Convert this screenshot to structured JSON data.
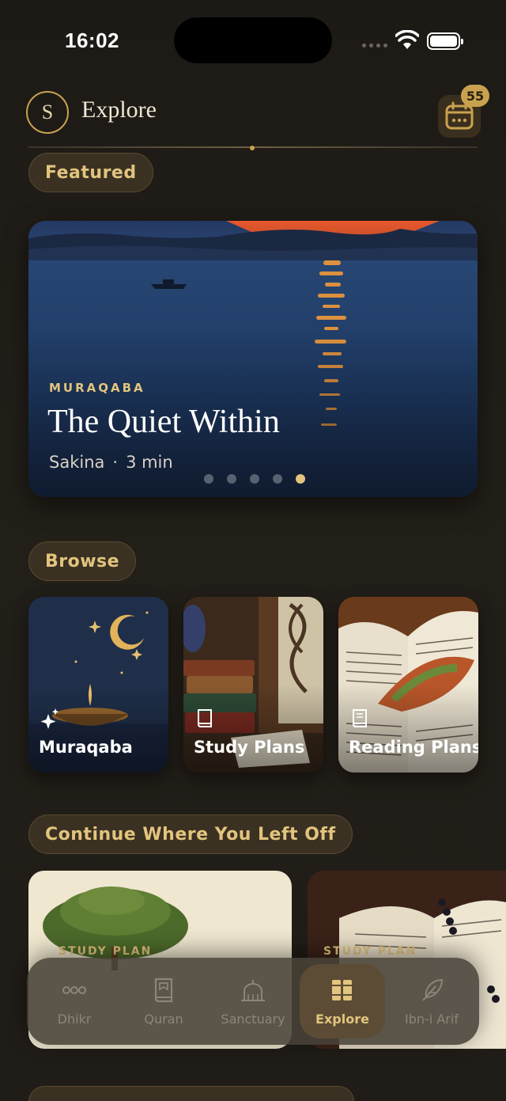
{
  "status_bar": {
    "time": "16:02"
  },
  "header": {
    "avatar_initial": "S",
    "title": "Explore",
    "notification_count": "55"
  },
  "featured": {
    "section_label": "Featured",
    "kicker": "MURAQABA",
    "title": "The Quiet Within",
    "author": "Sakina",
    "separator": "·",
    "duration": "3 min",
    "page_count": 5,
    "active_page": 5
  },
  "browse": {
    "section_label": "Browse",
    "cards": [
      {
        "label": "Muraqaba",
        "icon": "sparkles-icon"
      },
      {
        "label": "Study Plans",
        "icon": "book-icon"
      },
      {
        "label": "Reading Plans",
        "icon": "book-text-icon"
      }
    ]
  },
  "continue": {
    "section_label": "Continue Where You Left Off",
    "cards": [
      {
        "kicker": "STUDY PLAN"
      },
      {
        "kicker": "STUDY PLAN"
      }
    ]
  },
  "tabbar": {
    "items": [
      {
        "label": "Dhikr",
        "icon": "dots-icon",
        "active": false
      },
      {
        "label": "Quran",
        "icon": "book-icon",
        "active": false
      },
      {
        "label": "Sanctuary",
        "icon": "mosque-icon",
        "active": false
      },
      {
        "label": "Explore",
        "icon": "books-icon",
        "active": true
      },
      {
        "label": "Ibn-i Arif",
        "icon": "feather-icon",
        "active": false
      }
    ]
  },
  "colors": {
    "accent": "#c9a24f",
    "accent_text": "#e2c47e",
    "background": "#1f1b16"
  }
}
